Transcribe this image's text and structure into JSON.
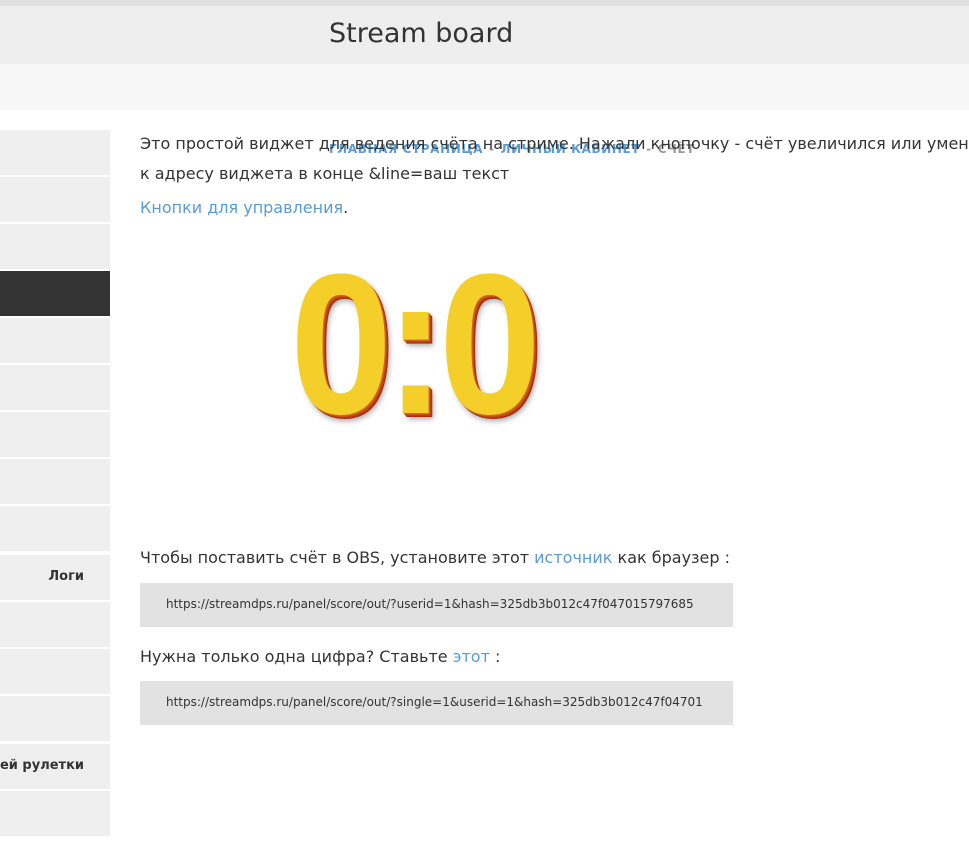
{
  "header": {
    "title": "Stream board"
  },
  "breadcrumbs": {
    "home": "ГЛАВНАЯ СТРАНИЦА",
    "sep1": "-",
    "cabinet": "ЛИЧНЫЙ КАБИНЕТ",
    "sep2": "-",
    "current": "СЧЁТ"
  },
  "sidebar": {
    "items": [
      {
        "label": ""
      },
      {
        "label": ""
      },
      {
        "label": ""
      },
      {
        "label": "",
        "active": true
      },
      {
        "label": ""
      },
      {
        "label": ""
      },
      {
        "label": ""
      },
      {
        "label": ""
      },
      {
        "label": ""
      },
      {
        "label": "Логи"
      },
      {
        "label": ""
      },
      {
        "label": ""
      },
      {
        "label": ""
      },
      {
        "label": "шей рулетки"
      },
      {
        "label": ""
      }
    ]
  },
  "main": {
    "intro_line1": "Это простой виджет для ведения счёта на стриме. Нажали кнопочку - счёт увеличился или уменьши",
    "intro_line2": "к адресу виджета в конце &line=ваш текст",
    "controls_link": "Кнопки для управления",
    "controls_dot": ".",
    "score": "0:0",
    "obs_text_before": "Чтобы поставить счёт в OBS, установите этот ",
    "obs_link": "источник",
    "obs_text_after": " как браузер :",
    "obs_url": "https://streamdps.ru/panel/score/out/?userid=1&hash=325db3b012c47f047015797685",
    "single_text_before": "Нужна только одна цифра? Ставьте ",
    "single_link": "этот",
    "single_text_after": " :",
    "single_url": "https://streamdps.ru/panel/score/out/?single=1&userid=1&hash=325db3b012c47f04701"
  },
  "colors": {
    "link": "#5b9bd5",
    "score_fill": "#f4cf2a",
    "score_shadow": "#b83a18",
    "sidebar_active": "#333333",
    "url_box": "#e2e2e2"
  }
}
